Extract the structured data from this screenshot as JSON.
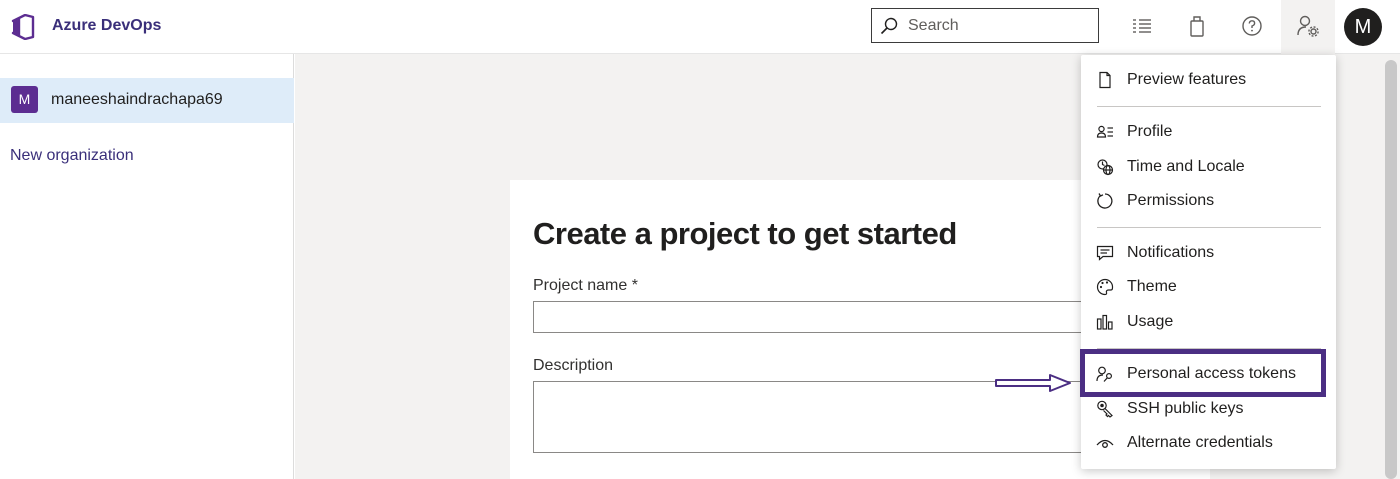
{
  "header": {
    "brand": "Azure DevOps",
    "search_placeholder": "Search",
    "avatar_initial": "M"
  },
  "sidebar": {
    "org_initial": "M",
    "org_name": "maneeshaindrachapa69",
    "new_org_label": "New organization"
  },
  "main": {
    "title": "Create a project to get started",
    "project_name_label": "Project name *",
    "description_label": "Description"
  },
  "user_menu": {
    "items": [
      {
        "label": "Preview features",
        "icon": "document-icon"
      },
      {
        "label": "Profile",
        "icon": "profile-icon"
      },
      {
        "label": "Time and Locale",
        "icon": "globe-icon"
      },
      {
        "label": "Permissions",
        "icon": "refresh-icon"
      },
      {
        "label": "Notifications",
        "icon": "chat-icon"
      },
      {
        "label": "Theme",
        "icon": "palette-icon"
      },
      {
        "label": "Usage",
        "icon": "bar-chart-icon"
      },
      {
        "label": "Personal access tokens",
        "icon": "key-person-icon"
      },
      {
        "label": "SSH public keys",
        "icon": "key-icon"
      },
      {
        "label": "Alternate credentials",
        "icon": "eye-icon"
      }
    ]
  },
  "colors": {
    "accent": "#3a2f7a",
    "highlight_box": "#4b2e83",
    "org_avatar": "#5c2d91",
    "selected_bg": "#deecf9"
  }
}
